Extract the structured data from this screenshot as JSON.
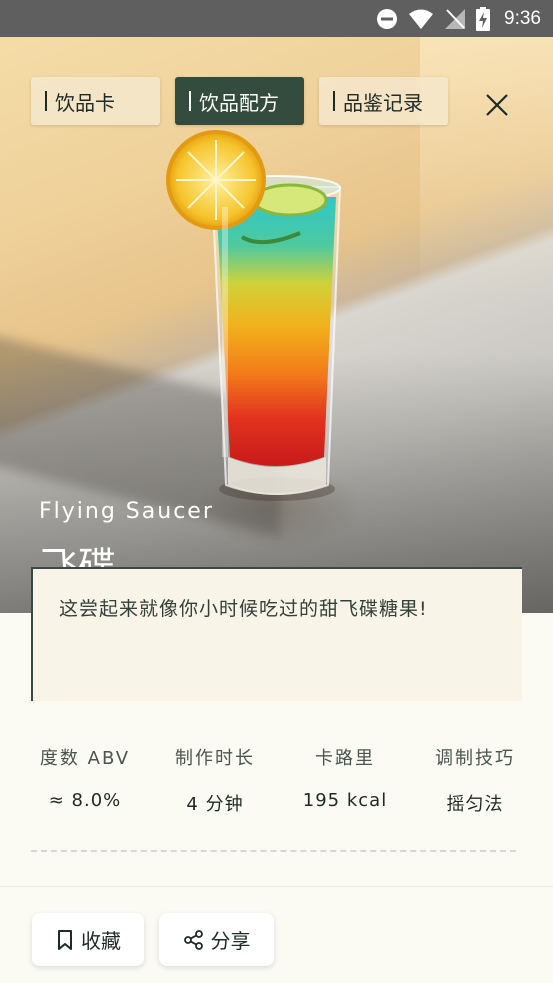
{
  "status_bar": {
    "time": "9:36"
  },
  "tabs": [
    {
      "label": "饮品卡",
      "active": false
    },
    {
      "label": "饮品配方",
      "active": true
    },
    {
      "label": "品鉴记录",
      "active": false
    }
  ],
  "drink": {
    "name_en": "Flying Saucer",
    "name_cn": "飞碟",
    "description": "这尝起来就像你小时候吃过的甜飞碟糖果!"
  },
  "stats": [
    {
      "label": "度数 ABV",
      "value": "≈ 8.0%"
    },
    {
      "label": "制作时长",
      "value": "4 分钟"
    },
    {
      "label": "卡路里",
      "value": "195 kcal"
    },
    {
      "label": "调制技巧",
      "value": "摇匀法"
    }
  ],
  "actions": {
    "favorite_label": "收藏",
    "share_label": "分享"
  },
  "colors": {
    "active_tab": "#344c3e",
    "accent_dark": "#1e2a25"
  }
}
